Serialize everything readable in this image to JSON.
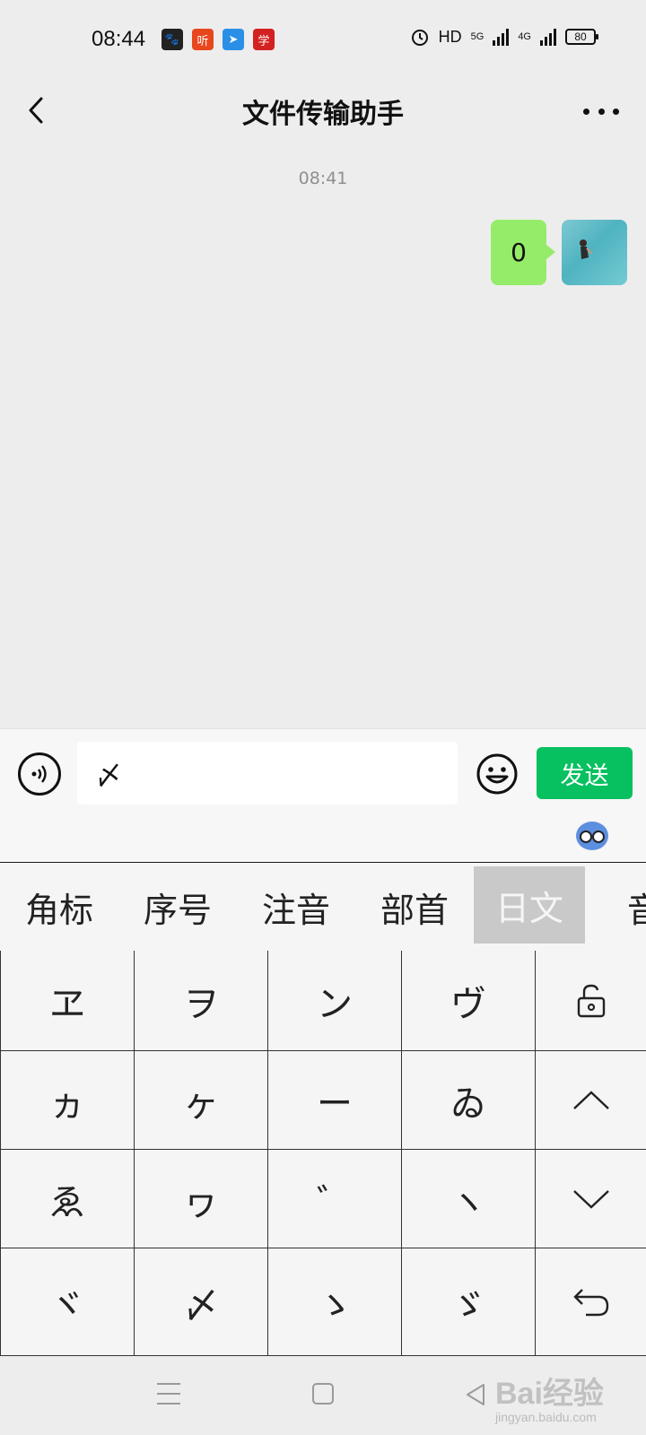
{
  "status_bar": {
    "time": "08:44",
    "app_icons": [
      {
        "name": "baidu-app-icon",
        "glyph": "🐾",
        "color": "#222222"
      },
      {
        "name": "ting-app-icon",
        "glyph": "听",
        "color": "#e8471e"
      },
      {
        "name": "paper-plane-app-icon",
        "glyph": "➤",
        "color": "#2a8fe6"
      },
      {
        "name": "xuexi-app-icon",
        "glyph": "学",
        "color": "#d32020"
      }
    ],
    "network_label": "HD",
    "signal_1_label": "5G",
    "signal_2_label": "4G",
    "battery": "80"
  },
  "nav": {
    "title": "文件传输助手"
  },
  "chat": {
    "timestamp": "08:41",
    "messages": [
      {
        "text": "0",
        "side": "right",
        "color": "#95ec69"
      }
    ]
  },
  "input_bar": {
    "value": "〆",
    "send_label": "发送",
    "send_color": "#07c160"
  },
  "ime": {
    "categories": [
      {
        "label": "角标",
        "active": false
      },
      {
        "label": "序号",
        "active": false
      },
      {
        "label": "注音",
        "active": false
      },
      {
        "label": "部首",
        "active": false
      },
      {
        "label": "日文",
        "active": true
      },
      {
        "label": "音",
        "active": false
      }
    ],
    "keys": [
      [
        "ヱ",
        "ヲ",
        "ン",
        "ヴ"
      ],
      [
        "ヵ",
        "ヶ",
        "ー",
        "ゐ"
      ],
      [
        "ゑ",
        "ヮ",
        "゛",
        "ヽ"
      ],
      [
        "ヾ",
        "〆",
        "ゝ",
        "ゞ"
      ]
    ],
    "side_keys": [
      "lock-icon",
      "up-arrow-icon",
      "down-arrow-icon",
      "return-icon"
    ]
  },
  "watermark": {
    "text": "Bai经验",
    "sub": "jingyan.baidu.com"
  }
}
